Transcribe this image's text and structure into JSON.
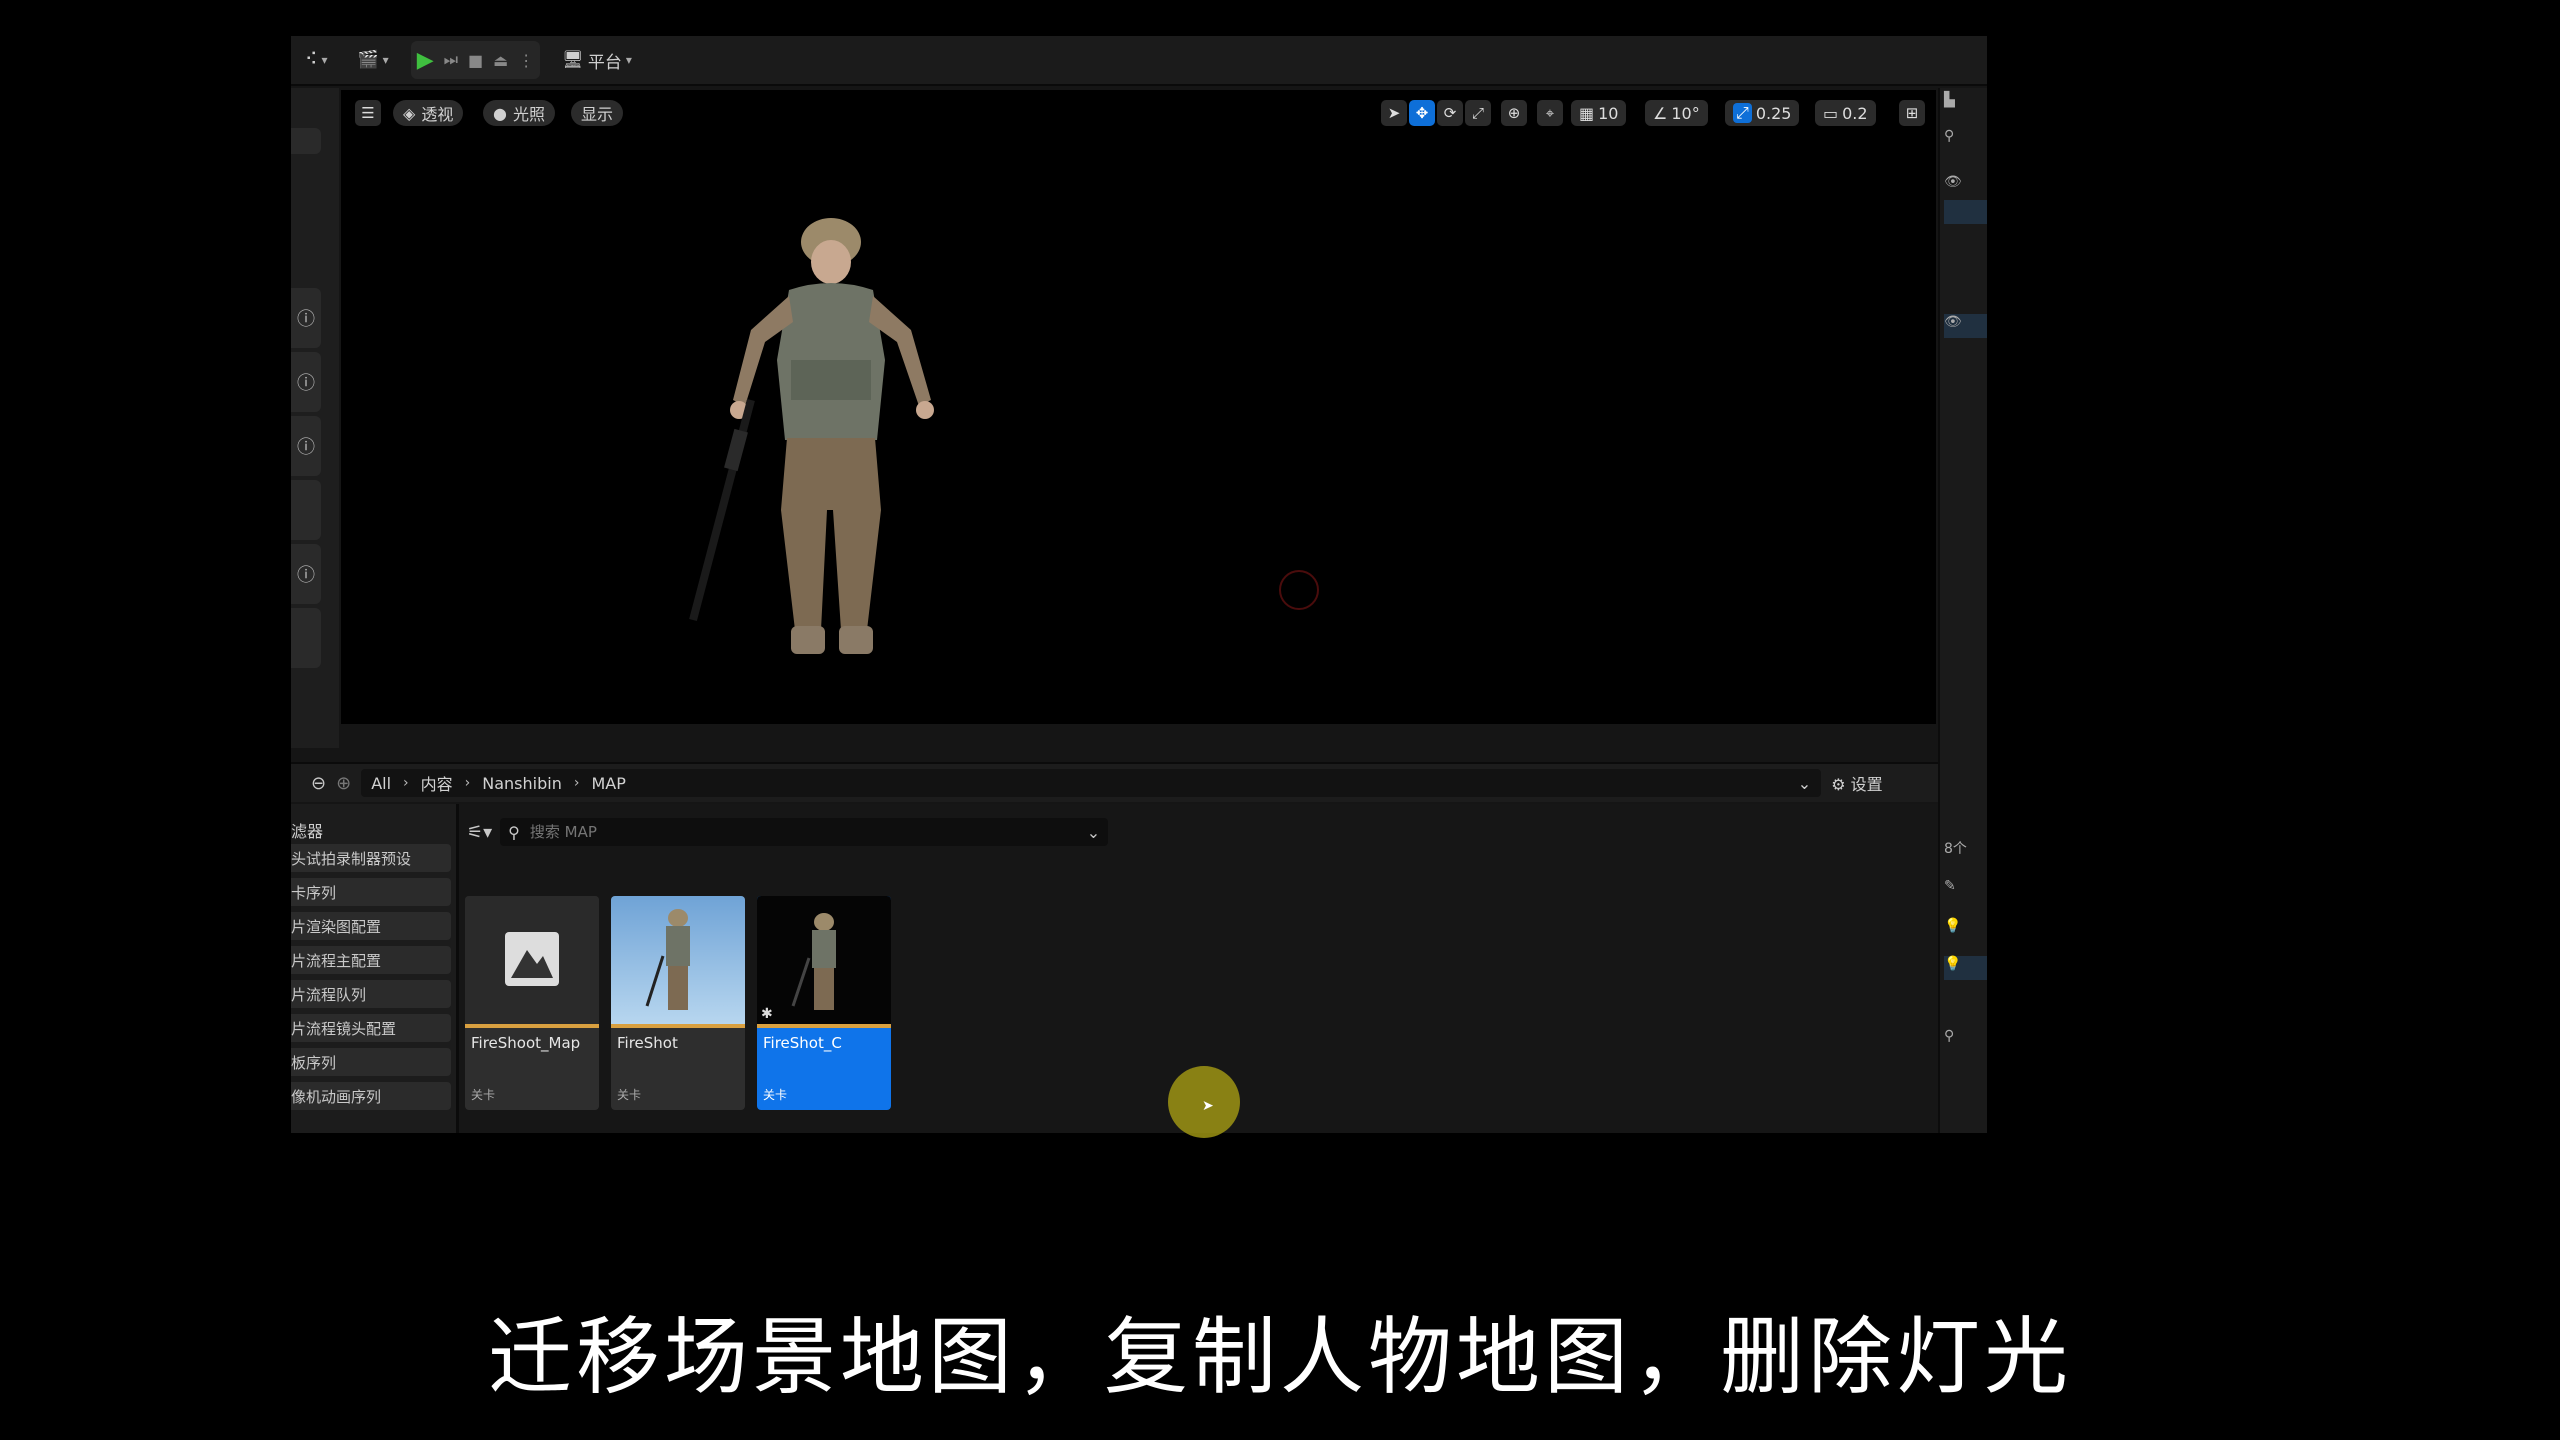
{
  "toolbar": {
    "platform_label": "平台"
  },
  "viewport": {
    "perspective_label": "透视",
    "lighting_label": "光照",
    "show_label": "显示",
    "grid_snap_value": "10",
    "rotation_snap_value": "10°",
    "scale_snap_value": "0.25",
    "camera_speed_value": "0.2"
  },
  "content_browser": {
    "breadcrumb": [
      "All",
      "内容",
      "Nanshibin",
      "MAP"
    ],
    "settings_label": "设置",
    "search_placeholder": "搜索 MAP",
    "sidebar_header": "滤器",
    "sidebar_items": [
      "头试拍录制器预设",
      "卡序列",
      "片渲染图配置",
      "片流程主配置",
      "片流程队列",
      "片流程镜头配置",
      "板序列",
      "像机动画序列"
    ],
    "assets": [
      {
        "name": "FireShoot_Map",
        "type": "关卡",
        "selected": false
      },
      {
        "name": "FireShot",
        "type": "关卡",
        "selected": false
      },
      {
        "name": "FireShot_C",
        "type": "关卡",
        "selected": true
      }
    ]
  },
  "right_panel": {
    "count_label": "8个"
  },
  "subtitle": "迁移场景地图，复制人物地图，删除灯光"
}
